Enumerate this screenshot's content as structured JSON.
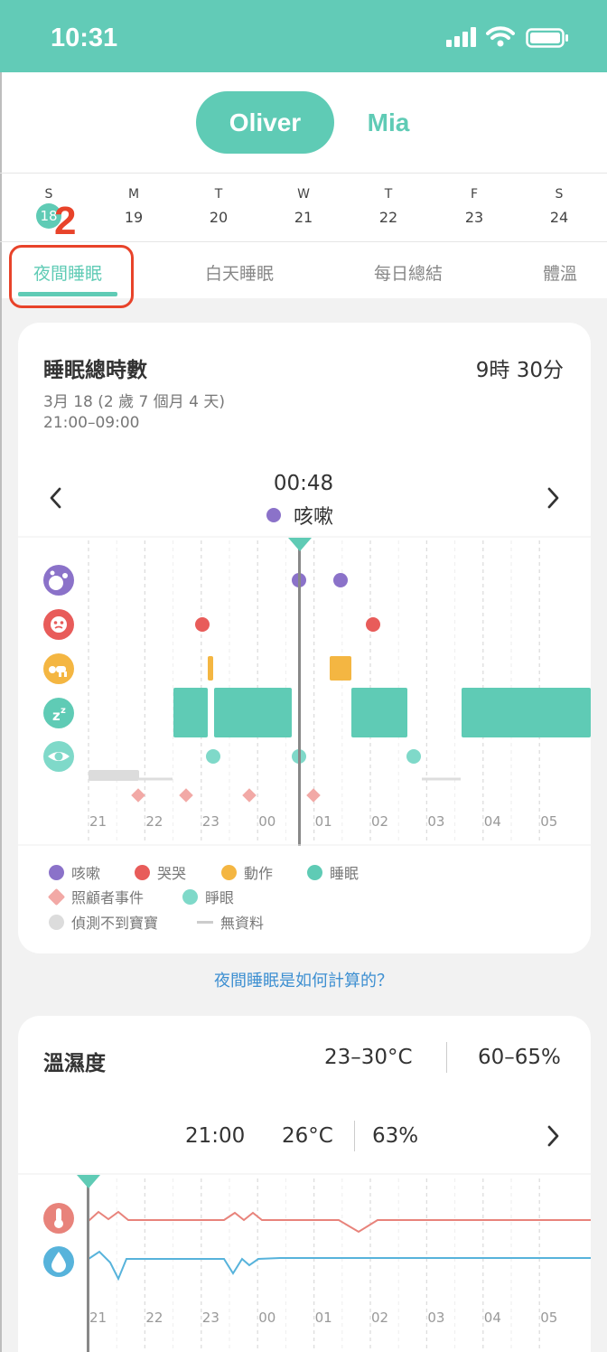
{
  "status": {
    "time": "10:31"
  },
  "profiles": {
    "active": "Oliver",
    "other": "Mia"
  },
  "week": [
    {
      "letter": "S",
      "num": "18"
    },
    {
      "letter": "M",
      "num": "19"
    },
    {
      "letter": "T",
      "num": "20"
    },
    {
      "letter": "W",
      "num": "21"
    },
    {
      "letter": "T",
      "num": "22"
    },
    {
      "letter": "F",
      "num": "23"
    },
    {
      "letter": "S",
      "num": "24"
    }
  ],
  "annotation": "2",
  "tabs": [
    "夜間睡眠",
    "白天睡眠",
    "每日總結",
    "體溫"
  ],
  "sleep_card": {
    "title": "睡眠總時數",
    "total": "9時 30分",
    "date": "3月 18 (2 歲 7 個月 4 天)",
    "range": "21:00–09:00",
    "cursor_time": "00:48",
    "cursor_event": "咳嗽",
    "hours": [
      "21",
      "22",
      "23",
      "00",
      "01",
      "02",
      "03",
      "04",
      "05"
    ],
    "legend": {
      "cough": "咳嗽",
      "cry": "哭哭",
      "move": "動作",
      "sleep": "睡眠",
      "caregiver": "照顧者事件",
      "awake": "睜眼",
      "undetected": "偵測不到寶寶",
      "nodata": "無資料"
    },
    "colors": {
      "cough": "#8b72c9",
      "cry": "#e85c5a",
      "move": "#f4b642",
      "sleep": "#5fcbb5",
      "awake": "#7fd9c9",
      "caregiver": "#f2a9a6"
    }
  },
  "link_text": "夜間睡眠是如何計算的？",
  "env_card": {
    "title": "溫濕度",
    "temp_range": "23–30°C",
    "hum_range": "60–65%",
    "cursor_time": "21:00",
    "cursor_temp": "26°C",
    "cursor_hum": "63%",
    "hours": [
      "21",
      "22",
      "23",
      "00",
      "01",
      "02",
      "03",
      "04",
      "05"
    ],
    "colors": {
      "temp": "#e8837b",
      "hum": "#57b3db"
    }
  }
}
